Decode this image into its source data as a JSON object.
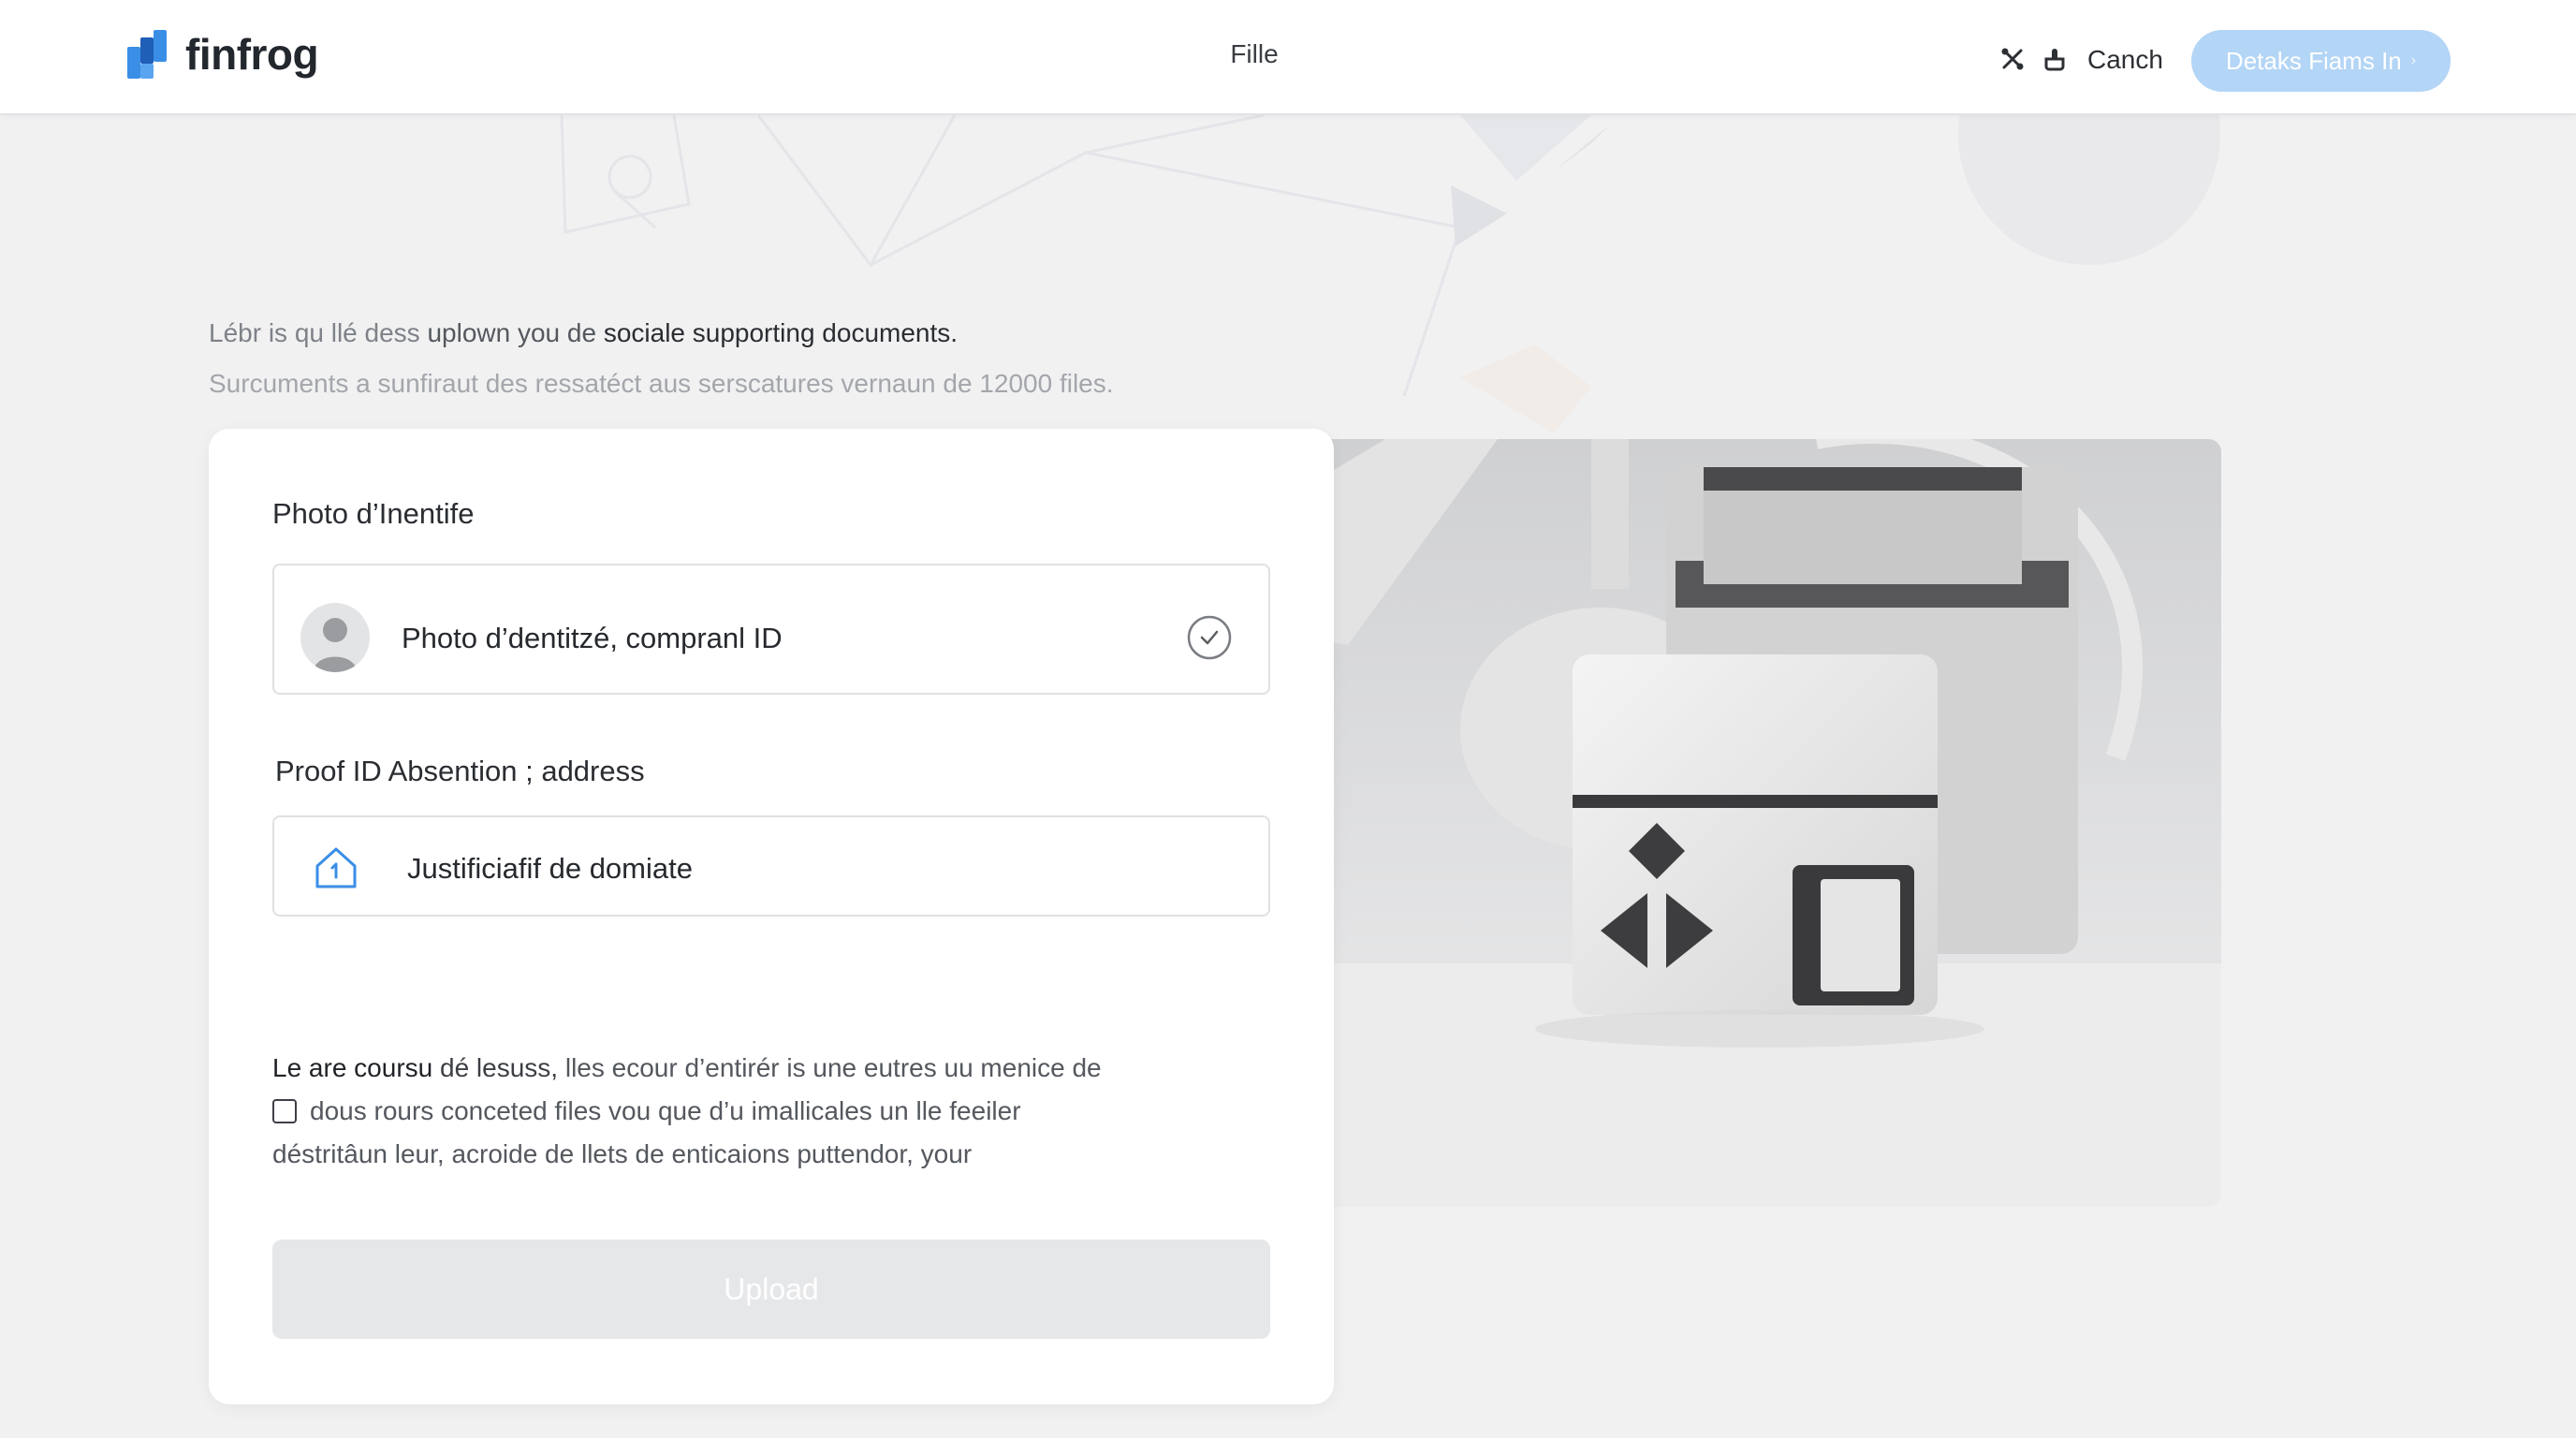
{
  "header": {
    "brand": "finfrog",
    "nav_center": "Fille",
    "icons": [
      "tools-icon",
      "hand-icon"
    ],
    "link": "Canch",
    "cta_label": "Detaks Fiams In"
  },
  "intro": {
    "line1_a": "Lébr is qu llé dess ",
    "line1_b": "uplown you de ",
    "line1_c": "sociale supporting documents.",
    "line2": "Surcuments a sunfiraut des ressatéct aus serscatures vernaun de 12000 files."
  },
  "form": {
    "section1_label": "Photo d’Inentife",
    "section1_value": "Photo d’dentitzé, compranl ID",
    "section2_label": "Proof ID Absention ; address",
    "section2_value": "Justificiafif de domiate",
    "consent_line1_bold": "Le are coursu",
    "consent_line1_mid": " dé lesuss,",
    "consent_line1_rest": " lles ecour d’entirér is une eutres uu menice de",
    "consent_line2": "dous rours conceted files vou que d’u imallicales un lle feeiler",
    "consent_line3": "déstritâun leur, acroide de llets de enticaions puttendor, your",
    "consent_checked": false,
    "upload_label": "Upload"
  },
  "colors": {
    "brand_blue": "#2f7fe0",
    "cta_bg": "#b3d5f6",
    "upload_bg": "#e6e7e9",
    "page_bg": "#f1f1f2"
  }
}
